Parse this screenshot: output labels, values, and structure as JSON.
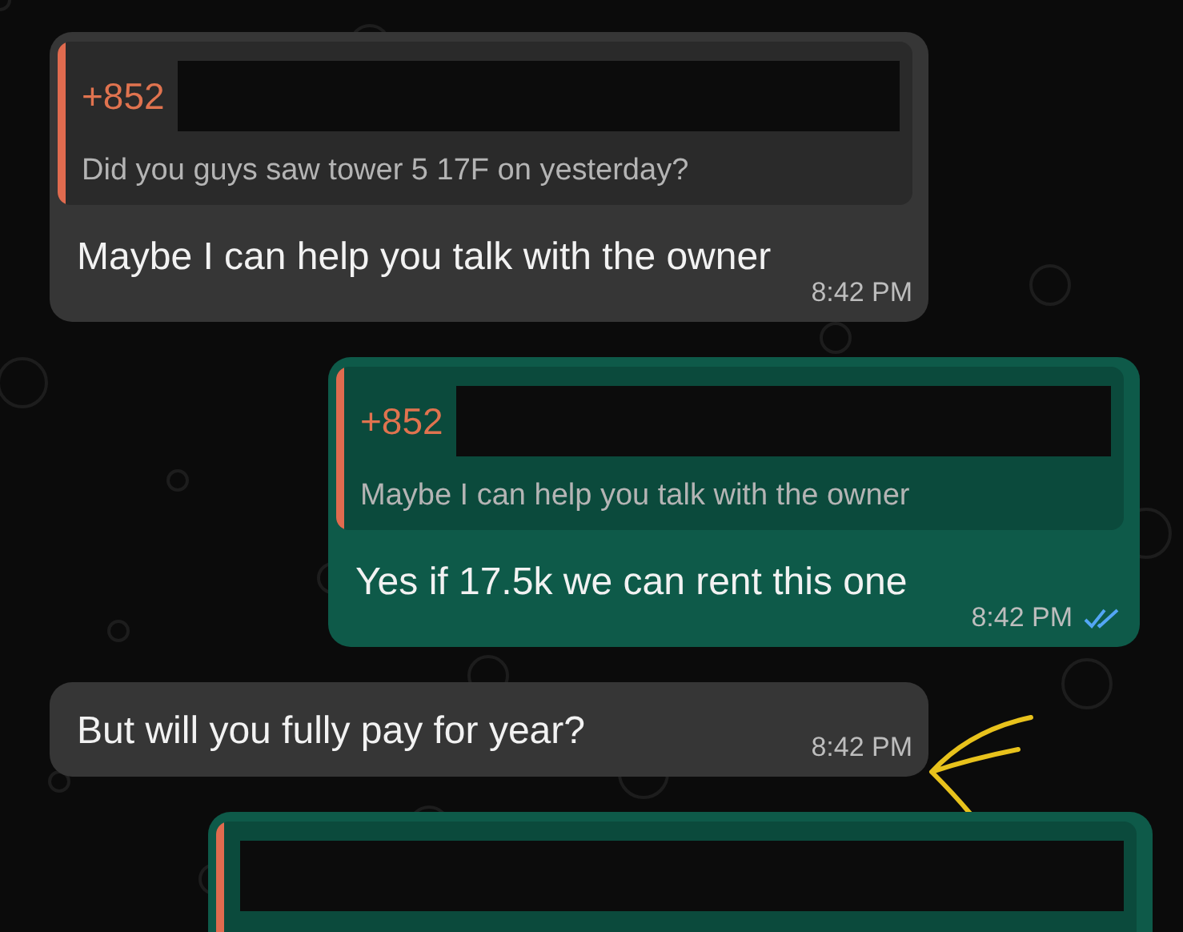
{
  "messages": [
    {
      "kind": "incoming",
      "quote": {
        "sender": "+852",
        "redacted": true,
        "text": "Did you guys saw tower 5  17F on yesterday?"
      },
      "text": "Maybe I can help you talk with the owner",
      "time": "8:42 PM"
    },
    {
      "kind": "outgoing",
      "quote": {
        "sender": "+852",
        "redacted": true,
        "text": "Maybe I can help you talk with the owner"
      },
      "text": "Yes if 17.5k we can rent this one",
      "time": "8:42 PM",
      "read": true
    },
    {
      "kind": "incoming",
      "text": "But will you fully pay for year?",
      "time": "8:42 PM",
      "annotation": {
        "kind": "arrow",
        "color": "#e8c21c"
      }
    },
    {
      "kind": "outgoing",
      "quote": {
        "redacted": true
      }
    }
  ]
}
